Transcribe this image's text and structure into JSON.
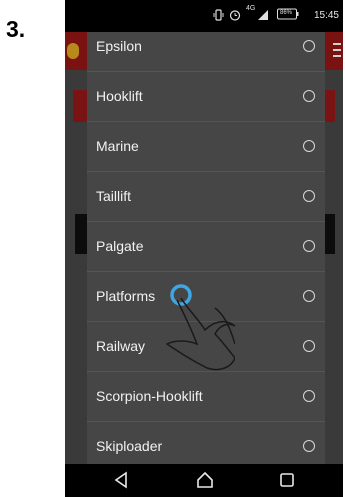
{
  "step_label": "3.",
  "status_bar": {
    "network": "4G",
    "battery": "86%",
    "time": "15:45"
  },
  "dialog": {
    "items": [
      {
        "label": "Epsilon"
      },
      {
        "label": "Hooklift"
      },
      {
        "label": "Marine"
      },
      {
        "label": "Taillift"
      },
      {
        "label": "Palgate"
      },
      {
        "label": "Platforms"
      },
      {
        "label": "Railway"
      },
      {
        "label": "Scorpion-Hooklift"
      },
      {
        "label": "Skiploader"
      }
    ]
  },
  "colors": {
    "dialog_bg": "#464646",
    "app_bar": "#7a1212",
    "selection_ring": "#3ea6e0"
  },
  "icons": [
    "vibrate-icon",
    "alarm-icon",
    "signal-icon",
    "battery-icon",
    "back-icon",
    "home-icon",
    "recents-icon",
    "hand-pointer-icon"
  ]
}
